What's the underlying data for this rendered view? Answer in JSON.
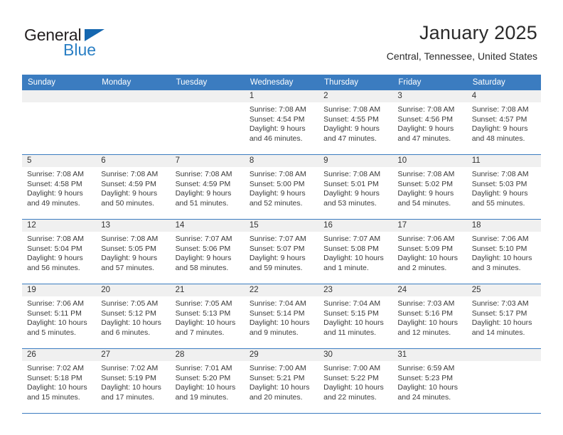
{
  "brand": {
    "name_part1": "General",
    "name_part2": "Blue",
    "triangle_color": "#1567b0",
    "blue_color": "#2a7fc4"
  },
  "header": {
    "title": "January 2025",
    "subtitle": "Central, Tennessee, United States"
  },
  "theme": {
    "header_blue": "#3b7cc0",
    "daynum_band": "#f0f0f0",
    "text": "#3a3a3a"
  },
  "weekdays": [
    "Sunday",
    "Monday",
    "Tuesday",
    "Wednesday",
    "Thursday",
    "Friday",
    "Saturday"
  ],
  "labels": {
    "sunrise": "Sunrise:",
    "sunset": "Sunset:",
    "daylight": "Daylight:"
  },
  "weeks": [
    [
      {
        "day": "",
        "sunrise": "",
        "sunset": "",
        "daylight": "",
        "empty": true
      },
      {
        "day": "",
        "sunrise": "",
        "sunset": "",
        "daylight": "",
        "empty": true
      },
      {
        "day": "",
        "sunrise": "",
        "sunset": "",
        "daylight": "",
        "empty": true
      },
      {
        "day": "1",
        "sunrise": "Sunrise: 7:08 AM",
        "sunset": "Sunset: 4:54 PM",
        "daylight": "Daylight: 9 hours and 46 minutes."
      },
      {
        "day": "2",
        "sunrise": "Sunrise: 7:08 AM",
        "sunset": "Sunset: 4:55 PM",
        "daylight": "Daylight: 9 hours and 47 minutes."
      },
      {
        "day": "3",
        "sunrise": "Sunrise: 7:08 AM",
        "sunset": "Sunset: 4:56 PM",
        "daylight": "Daylight: 9 hours and 47 minutes."
      },
      {
        "day": "4",
        "sunrise": "Sunrise: 7:08 AM",
        "sunset": "Sunset: 4:57 PM",
        "daylight": "Daylight: 9 hours and 48 minutes."
      }
    ],
    [
      {
        "day": "5",
        "sunrise": "Sunrise: 7:08 AM",
        "sunset": "Sunset: 4:58 PM",
        "daylight": "Daylight: 9 hours and 49 minutes."
      },
      {
        "day": "6",
        "sunrise": "Sunrise: 7:08 AM",
        "sunset": "Sunset: 4:59 PM",
        "daylight": "Daylight: 9 hours and 50 minutes."
      },
      {
        "day": "7",
        "sunrise": "Sunrise: 7:08 AM",
        "sunset": "Sunset: 4:59 PM",
        "daylight": "Daylight: 9 hours and 51 minutes."
      },
      {
        "day": "8",
        "sunrise": "Sunrise: 7:08 AM",
        "sunset": "Sunset: 5:00 PM",
        "daylight": "Daylight: 9 hours and 52 minutes."
      },
      {
        "day": "9",
        "sunrise": "Sunrise: 7:08 AM",
        "sunset": "Sunset: 5:01 PM",
        "daylight": "Daylight: 9 hours and 53 minutes."
      },
      {
        "day": "10",
        "sunrise": "Sunrise: 7:08 AM",
        "sunset": "Sunset: 5:02 PM",
        "daylight": "Daylight: 9 hours and 54 minutes."
      },
      {
        "day": "11",
        "sunrise": "Sunrise: 7:08 AM",
        "sunset": "Sunset: 5:03 PM",
        "daylight": "Daylight: 9 hours and 55 minutes."
      }
    ],
    [
      {
        "day": "12",
        "sunrise": "Sunrise: 7:08 AM",
        "sunset": "Sunset: 5:04 PM",
        "daylight": "Daylight: 9 hours and 56 minutes."
      },
      {
        "day": "13",
        "sunrise": "Sunrise: 7:08 AM",
        "sunset": "Sunset: 5:05 PM",
        "daylight": "Daylight: 9 hours and 57 minutes."
      },
      {
        "day": "14",
        "sunrise": "Sunrise: 7:07 AM",
        "sunset": "Sunset: 5:06 PM",
        "daylight": "Daylight: 9 hours and 58 minutes."
      },
      {
        "day": "15",
        "sunrise": "Sunrise: 7:07 AM",
        "sunset": "Sunset: 5:07 PM",
        "daylight": "Daylight: 9 hours and 59 minutes."
      },
      {
        "day": "16",
        "sunrise": "Sunrise: 7:07 AM",
        "sunset": "Sunset: 5:08 PM",
        "daylight": "Daylight: 10 hours and 1 minute."
      },
      {
        "day": "17",
        "sunrise": "Sunrise: 7:06 AM",
        "sunset": "Sunset: 5:09 PM",
        "daylight": "Daylight: 10 hours and 2 minutes."
      },
      {
        "day": "18",
        "sunrise": "Sunrise: 7:06 AM",
        "sunset": "Sunset: 5:10 PM",
        "daylight": "Daylight: 10 hours and 3 minutes."
      }
    ],
    [
      {
        "day": "19",
        "sunrise": "Sunrise: 7:06 AM",
        "sunset": "Sunset: 5:11 PM",
        "daylight": "Daylight: 10 hours and 5 minutes."
      },
      {
        "day": "20",
        "sunrise": "Sunrise: 7:05 AM",
        "sunset": "Sunset: 5:12 PM",
        "daylight": "Daylight: 10 hours and 6 minutes."
      },
      {
        "day": "21",
        "sunrise": "Sunrise: 7:05 AM",
        "sunset": "Sunset: 5:13 PM",
        "daylight": "Daylight: 10 hours and 7 minutes."
      },
      {
        "day": "22",
        "sunrise": "Sunrise: 7:04 AM",
        "sunset": "Sunset: 5:14 PM",
        "daylight": "Daylight: 10 hours and 9 minutes."
      },
      {
        "day": "23",
        "sunrise": "Sunrise: 7:04 AM",
        "sunset": "Sunset: 5:15 PM",
        "daylight": "Daylight: 10 hours and 11 minutes."
      },
      {
        "day": "24",
        "sunrise": "Sunrise: 7:03 AM",
        "sunset": "Sunset: 5:16 PM",
        "daylight": "Daylight: 10 hours and 12 minutes."
      },
      {
        "day": "25",
        "sunrise": "Sunrise: 7:03 AM",
        "sunset": "Sunset: 5:17 PM",
        "daylight": "Daylight: 10 hours and 14 minutes."
      }
    ],
    [
      {
        "day": "26",
        "sunrise": "Sunrise: 7:02 AM",
        "sunset": "Sunset: 5:18 PM",
        "daylight": "Daylight: 10 hours and 15 minutes."
      },
      {
        "day": "27",
        "sunrise": "Sunrise: 7:02 AM",
        "sunset": "Sunset: 5:19 PM",
        "daylight": "Daylight: 10 hours and 17 minutes."
      },
      {
        "day": "28",
        "sunrise": "Sunrise: 7:01 AM",
        "sunset": "Sunset: 5:20 PM",
        "daylight": "Daylight: 10 hours and 19 minutes."
      },
      {
        "day": "29",
        "sunrise": "Sunrise: 7:00 AM",
        "sunset": "Sunset: 5:21 PM",
        "daylight": "Daylight: 10 hours and 20 minutes."
      },
      {
        "day": "30",
        "sunrise": "Sunrise: 7:00 AM",
        "sunset": "Sunset: 5:22 PM",
        "daylight": "Daylight: 10 hours and 22 minutes."
      },
      {
        "day": "31",
        "sunrise": "Sunrise: 6:59 AM",
        "sunset": "Sunset: 5:23 PM",
        "daylight": "Daylight: 10 hours and 24 minutes."
      },
      {
        "day": "",
        "sunrise": "",
        "sunset": "",
        "daylight": "",
        "empty": true
      }
    ]
  ]
}
